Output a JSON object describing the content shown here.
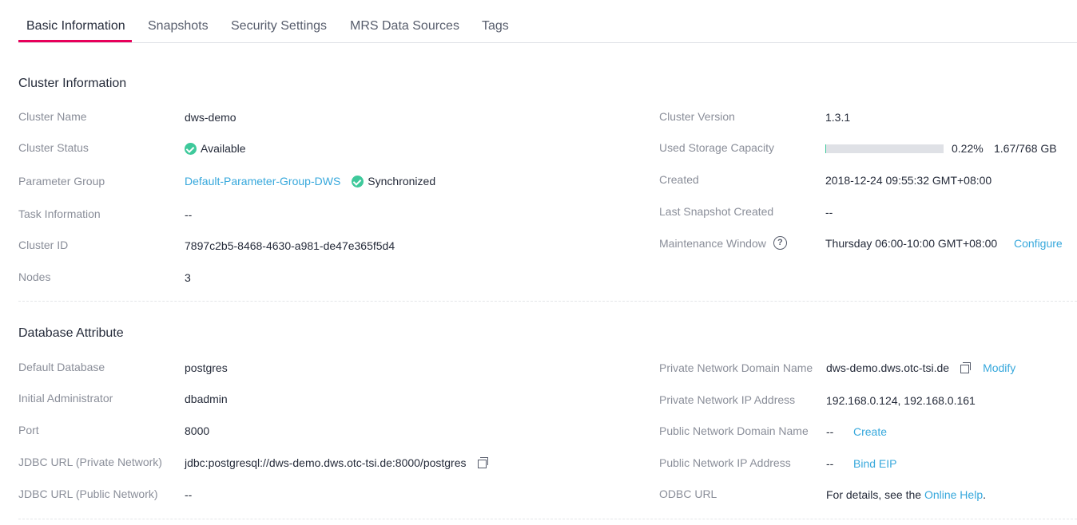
{
  "tabs": [
    {
      "label": "Basic Information",
      "active": true
    },
    {
      "label": "Snapshots"
    },
    {
      "label": "Security Settings"
    },
    {
      "label": "MRS Data Sources"
    },
    {
      "label": "Tags"
    }
  ],
  "cluster_info": {
    "title": "Cluster Information",
    "name_label": "Cluster Name",
    "name": "dws-demo",
    "status_label": "Cluster Status",
    "status": "Available",
    "param_group_label": "Parameter Group",
    "param_group": "Default-Parameter-Group-DWS",
    "param_group_status": "Synchronized",
    "task_label": "Task Information",
    "task": "--",
    "id_label": "Cluster ID",
    "id": "7897c2b5-8468-4630-a981-de47e365f5d4",
    "nodes_label": "Nodes",
    "nodes": "3",
    "version_label": "Cluster Version",
    "version": "1.3.1",
    "storage_label": "Used Storage Capacity",
    "storage_percent": "0.22%",
    "storage_used": "1.67/768 GB",
    "storage_fraction": 0.0022,
    "created_label": "Created",
    "created": "2018-12-24 09:55:32 GMT+08:00",
    "snapshot_label": "Last Snapshot Created",
    "snapshot": "--",
    "maintenance_label": "Maintenance Window",
    "maintenance": "Thursday 06:00-10:00 GMT+08:00",
    "configure_link": "Configure"
  },
  "db_attr": {
    "title": "Database Attribute",
    "default_db_label": "Default Database",
    "default_db": "postgres",
    "admin_label": "Initial Administrator",
    "admin": "dbadmin",
    "port_label": "Port",
    "port": "8000",
    "jdbc_private_label": "JDBC URL (Private Network)",
    "jdbc_private": "jdbc:postgresql://dws-demo.dws.otc-tsi.de:8000/postgres",
    "jdbc_public_label": "JDBC URL (Public Network)",
    "jdbc_public": "--",
    "private_domain_label": "Private Network Domain Name",
    "private_domain": "dws-demo.dws.otc-tsi.de",
    "modify_link": "Modify",
    "private_ip_label": "Private Network IP Address",
    "private_ip": "192.168.0.124, 192.168.0.161",
    "public_domain_label": "Public Network Domain Name",
    "public_domain": "--",
    "create_link": "Create",
    "public_ip_label": "Public Network IP Address",
    "public_ip": "--",
    "bind_eip_link": "Bind EIP",
    "odbc_label": "ODBC URL",
    "odbc_prefix": "For details, see the ",
    "odbc_link": "Online Help",
    "odbc_suffix": "."
  },
  "icons": {
    "status_ok": "check-circle-icon",
    "copy": "copy-icon",
    "help": "question-circle-icon"
  },
  "colors": {
    "accent": "#e8005a",
    "link": "#37a8dc",
    "ok": "#3ec99b",
    "label": "#8a8e99",
    "text": "#252b3a"
  }
}
